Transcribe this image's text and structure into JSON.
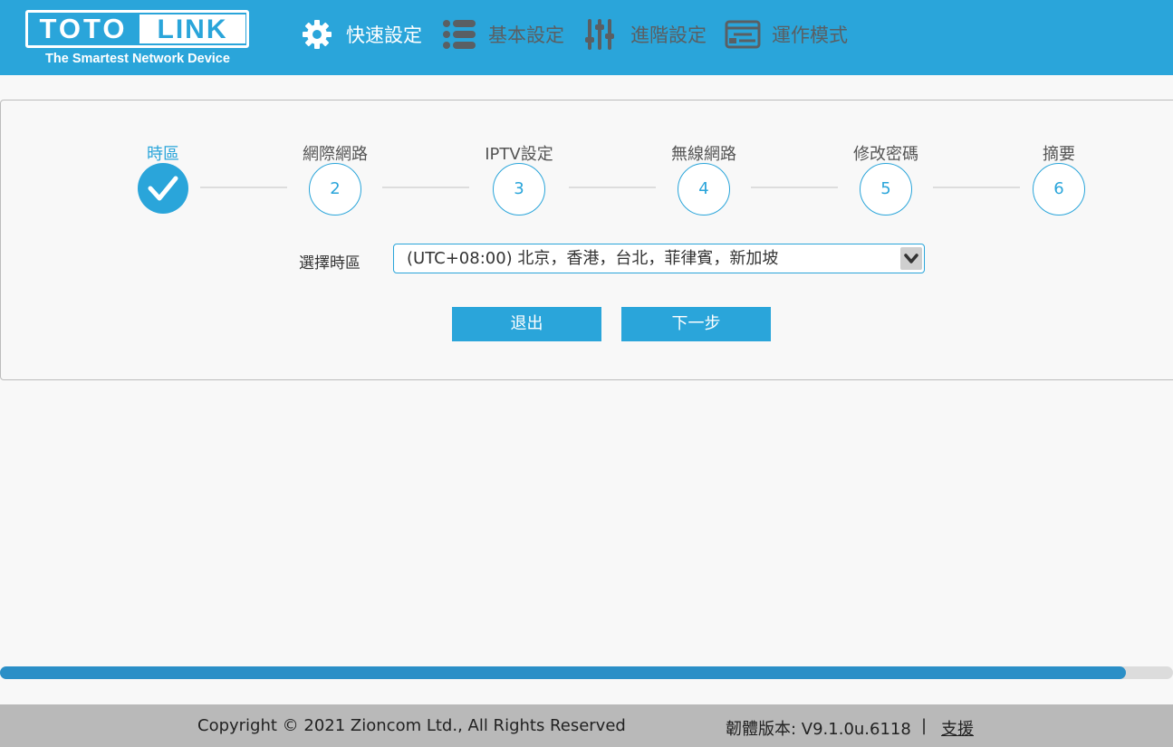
{
  "brand": {
    "logo_left": "TOTO",
    "logo_right": "LINK",
    "tagline": "The Smartest Network Device"
  },
  "nav": [
    {
      "label": "快速設定",
      "icon": "gear-icon",
      "active": true
    },
    {
      "label": "基本設定",
      "icon": "list-icon",
      "active": false
    },
    {
      "label": "進階設定",
      "icon": "sliders-icon",
      "active": false
    },
    {
      "label": "運作模式",
      "icon": "mode-icon",
      "active": false
    }
  ],
  "steps": [
    {
      "label": "時區",
      "number": "1",
      "done": true
    },
    {
      "label": "網際網路",
      "number": "2",
      "done": false
    },
    {
      "label": "IPTV設定",
      "number": "3",
      "done": false
    },
    {
      "label": "無線網路",
      "number": "4",
      "done": false
    },
    {
      "label": "修改密碼",
      "number": "5",
      "done": false
    },
    {
      "label": "摘要",
      "number": "6",
      "done": false
    }
  ],
  "timezone": {
    "label": "選擇時區",
    "selected": "(UTC+08:00) 北京，香港，台北，菲律賓，新加坡"
  },
  "buttons": {
    "exit": "退出",
    "next": "下一步"
  },
  "progress": {
    "fraction": 0.96
  },
  "footer": {
    "copyright": "Copyright © 2021 Zioncom Ltd., All Rights Reserved",
    "firmware": "韌體版本: V9.1.0u.6118",
    "separator": "|",
    "support": "支援"
  },
  "colors": {
    "accent": "#2aa5da",
    "nav_inactive": "#5a5f63",
    "footer_bg": "#b9b9b9",
    "progress": "#2b8fc7"
  }
}
